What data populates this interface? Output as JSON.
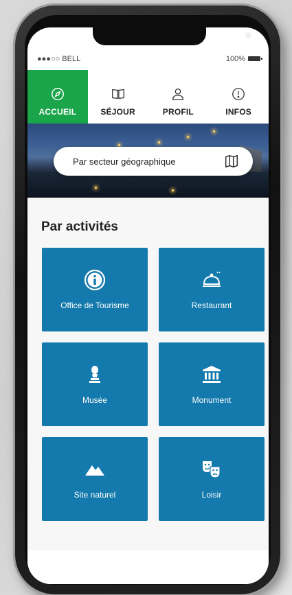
{
  "status_bar": {
    "carrier": "●●●○○ BELL",
    "battery": "100%"
  },
  "tabs": [
    {
      "label": "ACCUEIL",
      "icon": "compass-icon",
      "active": true
    },
    {
      "label": "SÉJOUR",
      "icon": "book-icon",
      "active": false
    },
    {
      "label": "PROFIL",
      "icon": "user-icon",
      "active": false
    },
    {
      "label": "INFOS",
      "icon": "info-circle-icon",
      "active": false
    }
  ],
  "hero": {
    "search_label": "Par secteur géographique",
    "search_icon": "map-icon"
  },
  "section": {
    "title": "Par activités"
  },
  "activities": [
    {
      "label": "Office de Tourisme",
      "icon": "info-icon"
    },
    {
      "label": "Restaurant",
      "icon": "cloche-icon"
    },
    {
      "label": "Musée",
      "icon": "bust-icon"
    },
    {
      "label": "Monument",
      "icon": "monument-icon"
    },
    {
      "label": "Site naturel",
      "icon": "mountain-icon"
    },
    {
      "label": "Loisir",
      "icon": "theater-masks-icon"
    }
  ],
  "colors": {
    "active_tab": "#1aa54b",
    "card": "#1479ac"
  }
}
